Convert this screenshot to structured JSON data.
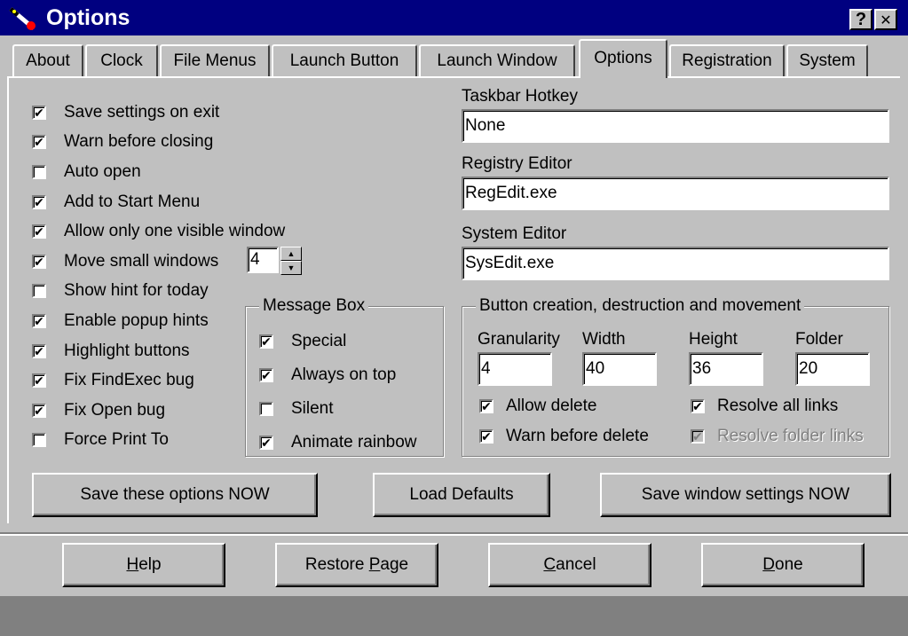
{
  "window": {
    "title": "Options",
    "help_glyph": "?",
    "close_glyph": "✕",
    "title_icon": "wand-icon"
  },
  "tabs": [
    {
      "label": "About"
    },
    {
      "label": "Clock"
    },
    {
      "label": "File Menus"
    },
    {
      "label": "Launch Button"
    },
    {
      "label": "Launch Window"
    },
    {
      "label": "Options",
      "active": true
    },
    {
      "label": "Registration"
    },
    {
      "label": "System"
    }
  ],
  "options": [
    {
      "label": "Save settings on exit",
      "checked": true
    },
    {
      "label": "Warn before closing",
      "checked": true
    },
    {
      "label": "Auto open",
      "checked": false
    },
    {
      "label": "Add to Start Menu",
      "checked": true
    },
    {
      "label": "Allow only one visible window",
      "checked": true
    },
    {
      "label": "Move small windows",
      "checked": true
    },
    {
      "label": "Show hint for today",
      "checked": false
    },
    {
      "label": "Enable popup hints",
      "checked": true
    },
    {
      "label": "Highlight buttons",
      "checked": true
    },
    {
      "label": "Fix FindExec bug",
      "checked": true
    },
    {
      "label": "Fix Open bug",
      "checked": true
    },
    {
      "label": "Force Print To",
      "checked": false
    }
  ],
  "move_small_windows_value": "4",
  "spinner": {
    "up_glyph": "▲",
    "down_glyph": "▼"
  },
  "check_glyph": "✔",
  "message_box": {
    "title": "Message Box",
    "items": [
      {
        "label": "Special",
        "checked": true
      },
      {
        "label": "Always on top",
        "checked": true
      },
      {
        "label": "Silent",
        "checked": false
      },
      {
        "label": "Animate rainbow",
        "checked": true
      }
    ]
  },
  "taskbar_hotkey": {
    "label": "Taskbar Hotkey",
    "value": "None"
  },
  "registry_editor": {
    "label": "Registry Editor",
    "value": "RegEdit.exe"
  },
  "system_editor": {
    "label": "System Editor",
    "value": "SysEdit.exe"
  },
  "button_creation": {
    "title": "Button creation, destruction and movement",
    "granularity": {
      "label": "Granularity",
      "value": "4"
    },
    "width": {
      "label": "Width",
      "value": "40"
    },
    "height": {
      "label": "Height",
      "value": "36"
    },
    "folder": {
      "label": "Folder",
      "value": "20"
    },
    "allow_delete": {
      "label": "Allow delete",
      "checked": true
    },
    "warn_before_delete": {
      "label": "Warn before delete",
      "checked": true
    },
    "resolve_all_links": {
      "label": "Resolve all links",
      "checked": true
    },
    "resolve_folder_links": {
      "label": "Resolve folder links",
      "checked": true,
      "disabled": true
    }
  },
  "actions": {
    "save_options": "Save these options NOW",
    "load_defaults": "Load Defaults",
    "save_window": "Save window settings NOW"
  },
  "footer": {
    "help": {
      "label": "Help",
      "accel": "H",
      "rest": "elp",
      "pre": ""
    },
    "restore": {
      "label": "Restore Page",
      "pre": "Restore ",
      "accel": "P",
      "rest": "age"
    },
    "cancel": {
      "label": "Cancel",
      "accel": "C",
      "rest": "ancel",
      "pre": ""
    },
    "done": {
      "label": "Done",
      "accel": "D",
      "rest": "one",
      "pre": ""
    }
  }
}
